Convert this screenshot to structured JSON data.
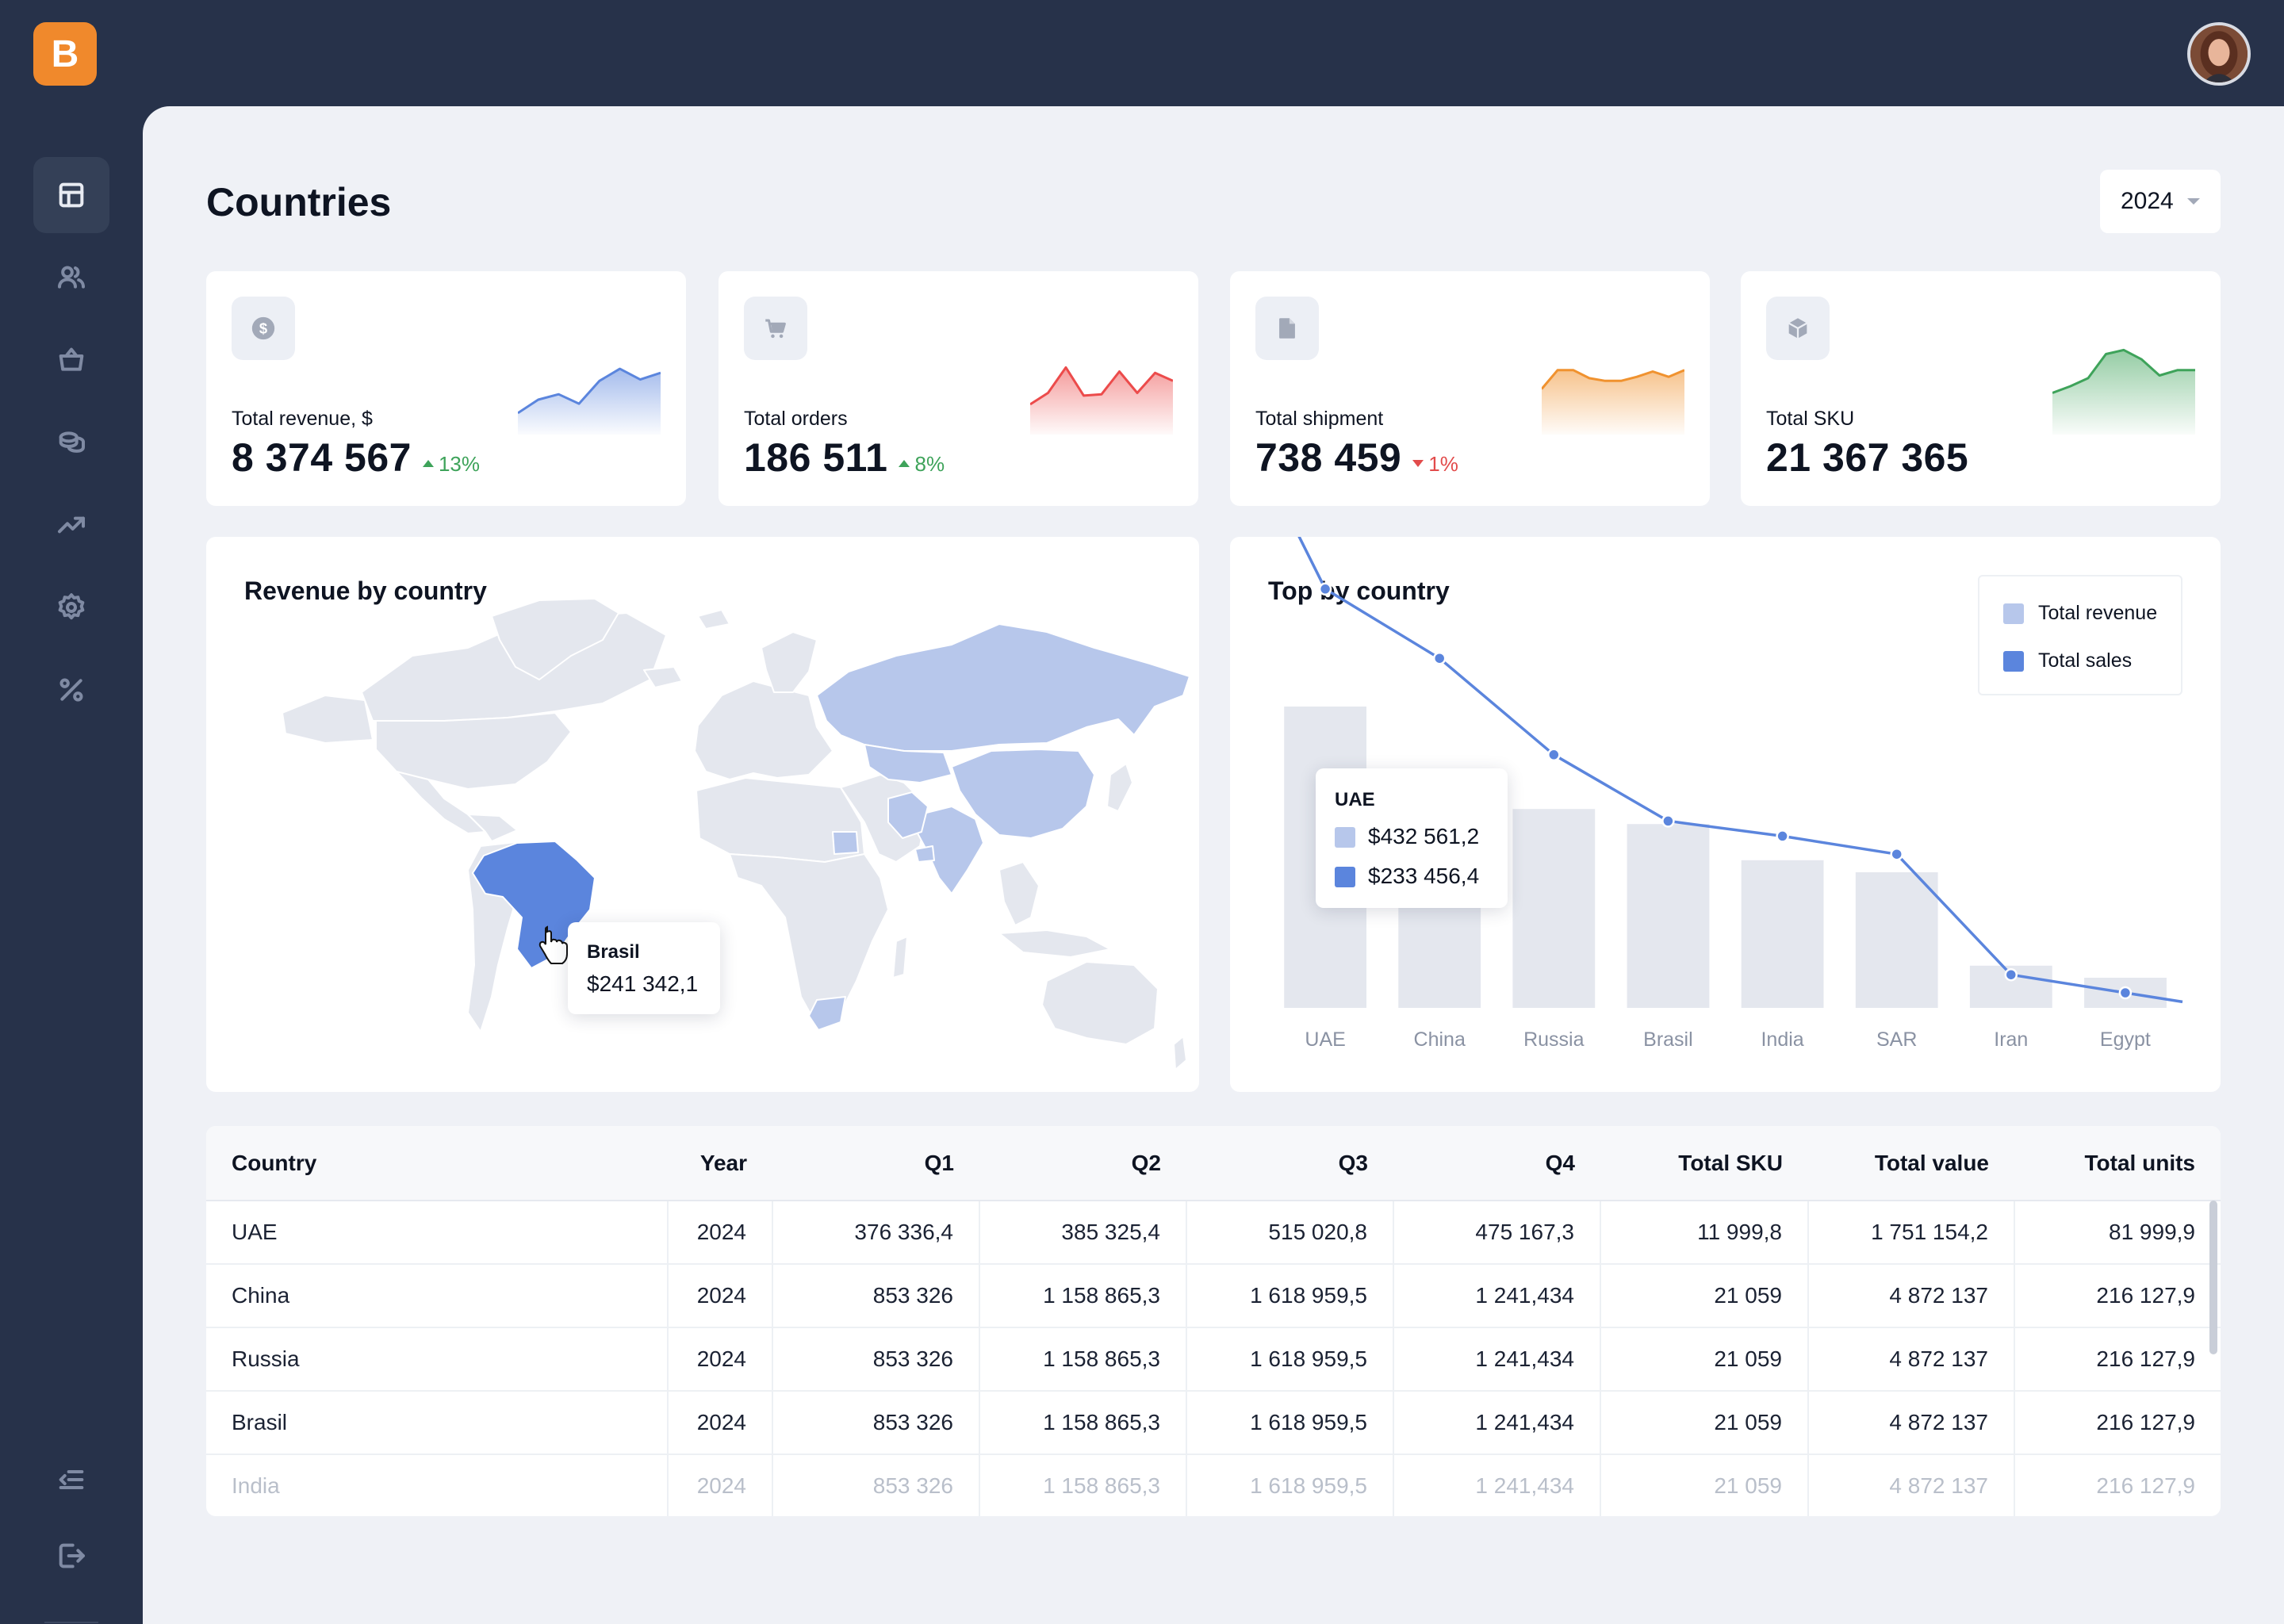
{
  "app": {
    "logo_letter": "B"
  },
  "nav": [
    {
      "name": "dashboard-icon",
      "active": true
    },
    {
      "name": "users-icon",
      "active": false
    },
    {
      "name": "basket-icon",
      "active": false
    },
    {
      "name": "coins-icon",
      "active": false
    },
    {
      "name": "trending-up-icon",
      "active": false
    },
    {
      "name": "gear-icon",
      "active": false
    },
    {
      "name": "percent-icon",
      "active": false
    }
  ],
  "page": {
    "title": "Countries",
    "year": "2024"
  },
  "kpis": [
    {
      "label": "Total revenue, $",
      "value": "8 374 567",
      "change": "13%",
      "direction": "up",
      "color": "#5b85dd",
      "icon": "dollar-icon",
      "trend": [
        32,
        52,
        60,
        46,
        80,
        98,
        82,
        92
      ]
    },
    {
      "label": "Total orders",
      "value": "186 511",
      "change": "8%",
      "direction": "up",
      "color": "#ec4b4b",
      "icon": "cart-icon",
      "trend": [
        45,
        62,
        100,
        58,
        60,
        94,
        62,
        92,
        80
      ]
    },
    {
      "label": "Total shipment",
      "value": "738 459",
      "change": "1%",
      "direction": "down",
      "color": "#f0922f",
      "icon": "file-icon",
      "trend": [
        68,
        96,
        96,
        84,
        80,
        80,
        86,
        94,
        86,
        96
      ]
    },
    {
      "label": "Total SKU",
      "value": "21 367 365",
      "change": "",
      "direction": "",
      "color": "#3ea35a",
      "icon": "cube-icon",
      "trend": [
        62,
        72,
        84,
        120,
        126,
        112,
        88,
        96,
        96
      ]
    }
  ],
  "revenue_map": {
    "title": "Revenue by country",
    "tooltip": {
      "country": "Brasil",
      "value": "$241 342,1"
    }
  },
  "chart_data": {
    "type": "bar",
    "title": "Top by country",
    "categories": [
      "UAE",
      "China",
      "Russia",
      "Brasil",
      "India",
      "SAR",
      "Iran",
      "Egypt"
    ],
    "series": [
      {
        "name": "Total revenue",
        "kind": "bar",
        "color": "#e4e7ee",
        "values": [
          100,
          63,
          66,
          61,
          49,
          45,
          14,
          10
        ]
      },
      {
        "name": "Total sales",
        "kind": "line",
        "color": "#5b85dd",
        "values": [
          139,
          116,
          84,
          62,
          57,
          51,
          11,
          5
        ]
      }
    ],
    "legend": "top-right",
    "ylim": [
      0,
      140
    ],
    "tooltip": {
      "category": "UAE",
      "revenue": "$432 561,2",
      "sales": "$233 456,4"
    }
  },
  "table": {
    "columns": [
      "Country",
      "Year",
      "Q1",
      "Q2",
      "Q3",
      "Q4",
      "Total SKU",
      "Total value",
      "Total units"
    ],
    "rows": [
      [
        "UAE",
        "2024",
        "376 336,4",
        "385 325,4",
        "515 020,8",
        "475 167,3",
        "11 999,8",
        "1 751 154,2",
        "81 999,9"
      ],
      [
        "China",
        "2024",
        "853 326",
        "1 158 865,3",
        "1 618 959,5",
        "1 241,434",
        "21 059",
        "4 872 137",
        "216 127,9"
      ],
      [
        "Russia",
        "2024",
        "853 326",
        "1 158 865,3",
        "1 618 959,5",
        "1 241,434",
        "21 059",
        "4 872 137",
        "216 127,9"
      ],
      [
        "Brasil",
        "2024",
        "853 326",
        "1 158 865,3",
        "1 618 959,5",
        "1 241,434",
        "21 059",
        "4 872 137",
        "216 127,9"
      ],
      [
        "India",
        "2024",
        "853 326",
        "1 158 865,3",
        "1 618 959,5",
        "1 241,434",
        "21 059",
        "4 872 137",
        "216 127,9"
      ]
    ]
  }
}
